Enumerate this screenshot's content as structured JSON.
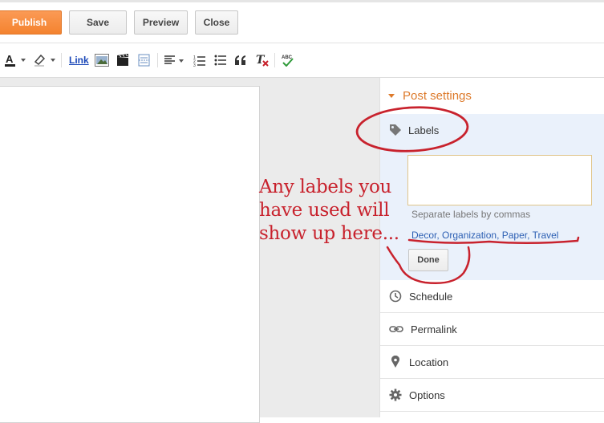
{
  "topbar": {
    "publish_label": "Publish",
    "save_label": "Save",
    "preview_label": "Preview",
    "close_label": "Close"
  },
  "toolbar": {
    "link_label": "Link"
  },
  "sidebar": {
    "post_settings_title": "Post settings",
    "labels": {
      "title": "Labels",
      "input_value": "",
      "hint": "Separate labels by commas",
      "existing": [
        "Decor",
        "Organization",
        "Paper",
        "Travel"
      ],
      "done_label": "Done"
    },
    "rows": [
      {
        "label": "Schedule",
        "icon": "clock-icon"
      },
      {
        "label": "Permalink",
        "icon": "link-icon"
      },
      {
        "label": "Location",
        "icon": "map-pin-icon"
      },
      {
        "label": "Options",
        "icon": "gear-icon"
      }
    ]
  },
  "annotation": {
    "line1": "Any labels you",
    "line2": "have used will",
    "line3": "show up here...",
    "color": "#c8222d"
  },
  "colors": {
    "publish": "#f4832f",
    "post_settings": "#dd7a2b",
    "labels_panel": "#eaf1fb",
    "label_link": "#2c5fb3"
  }
}
